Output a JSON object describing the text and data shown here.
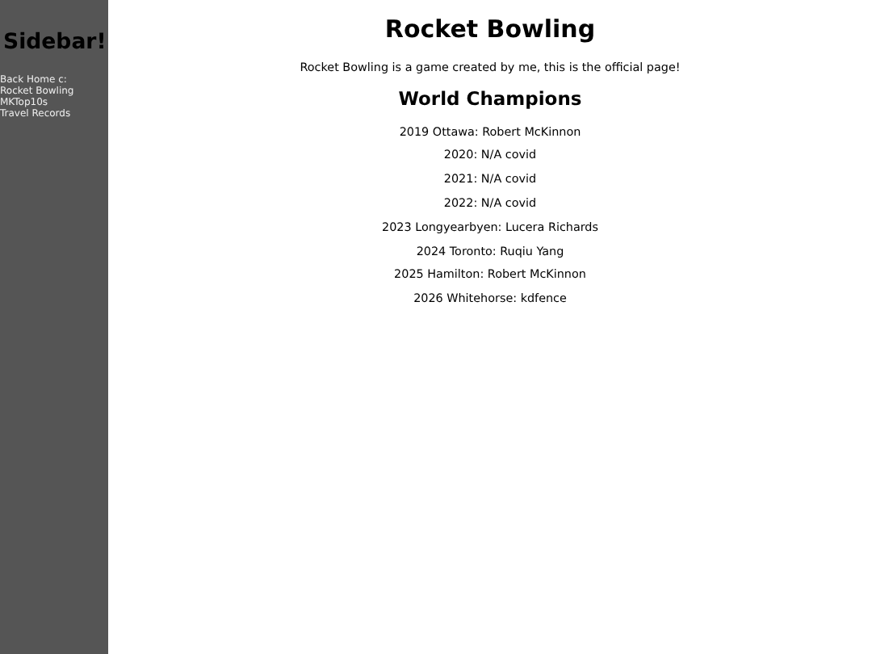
{
  "sidebar": {
    "title": "Sidebar!",
    "links": [
      "Back Home c:",
      "Rocket Bowling",
      "MKTop10s",
      "Travel Records"
    ]
  },
  "main": {
    "title": "Rocket Bowling",
    "intro": "Rocket Bowling is a game created by me, this is the official page!",
    "section_title": "World Champions",
    "champions": [
      "2019 Ottawa: Robert McKinnon",
      "2020: N/A covid",
      "2021: N/A covid",
      "2022: N/A covid",
      "2023 Longyearbyen: Lucera Richards",
      "2024 Toronto: Ruqiu Yang",
      "2025 Hamilton: Robert McKinnon",
      "2026 Whitehorse: kdfence"
    ]
  }
}
